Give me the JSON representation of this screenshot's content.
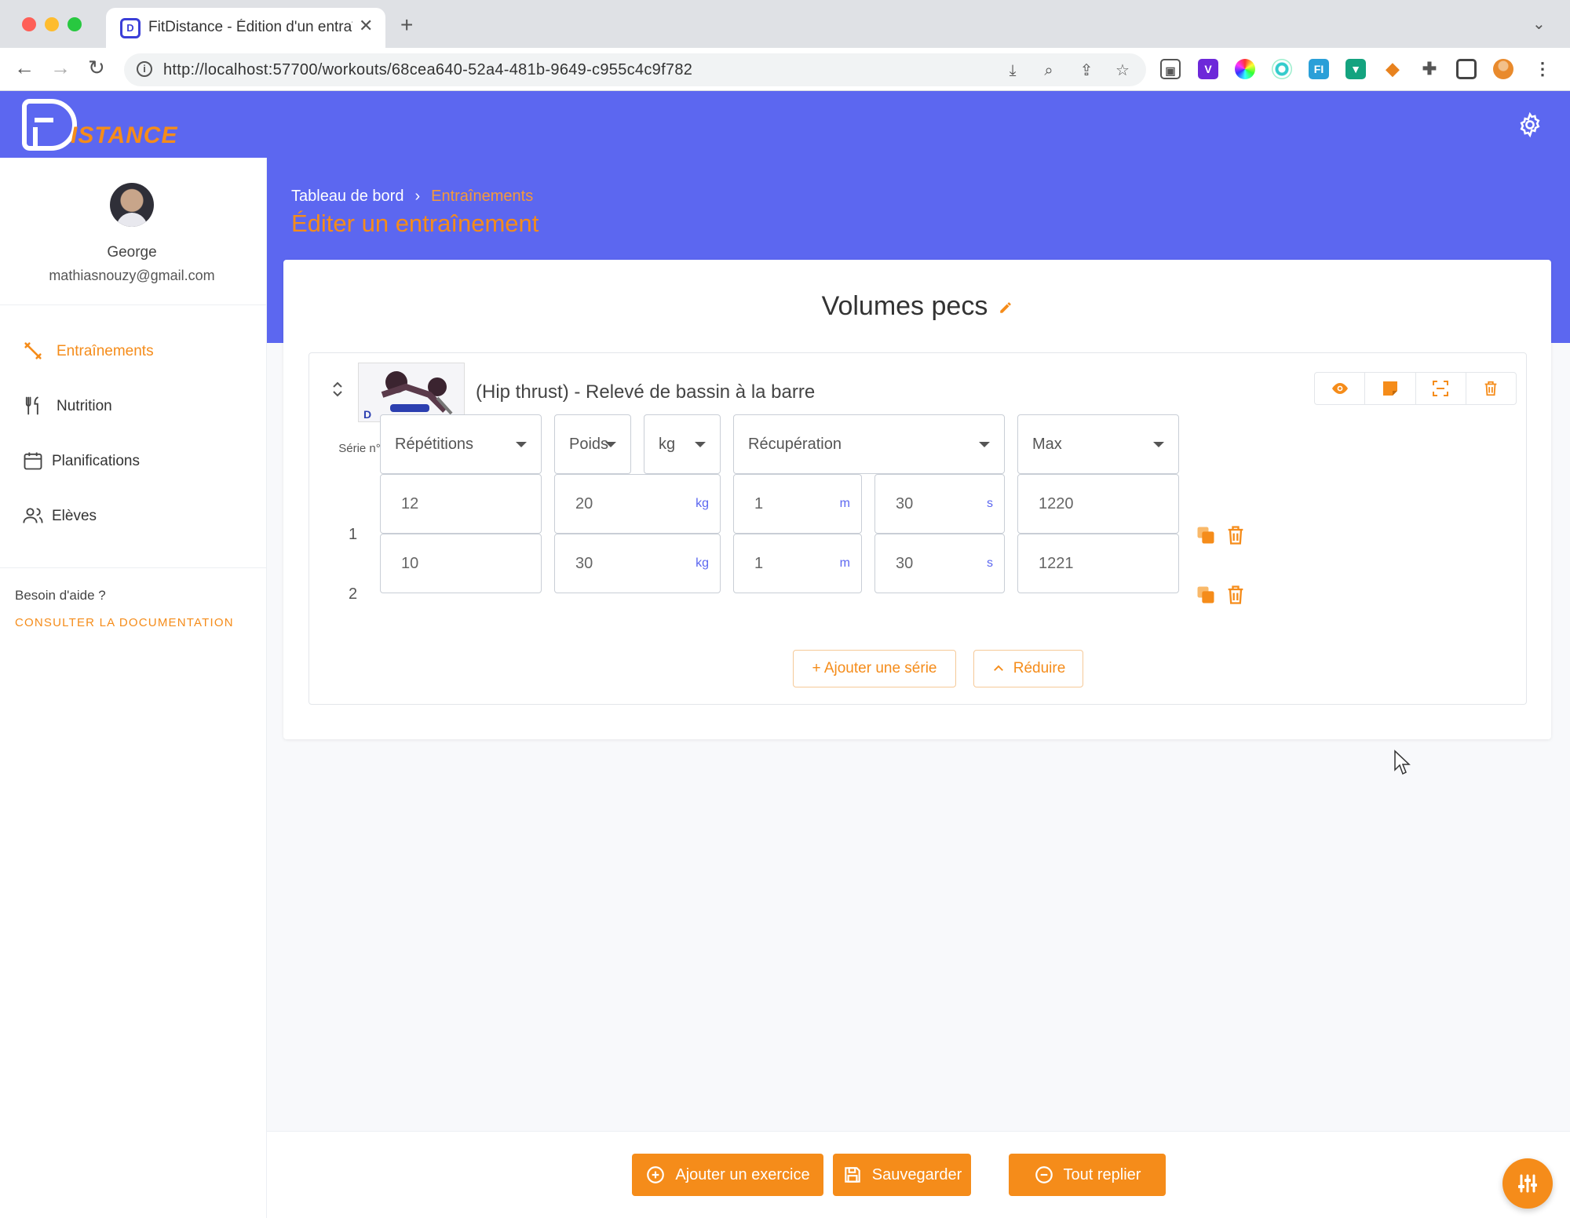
{
  "browser": {
    "tab_title": "FitDistance - Édition d'un entraî",
    "url": "http://localhost:57700/workouts/68cea640-52a4-481b-9649-c955c4c9f782"
  },
  "app": {
    "logo_text": "ISTANCE",
    "accent": "#f58c1a",
    "brand": "#5c67f0"
  },
  "user": {
    "name": "George",
    "email": "mathiasnouzy@gmail.com"
  },
  "sidebar": {
    "items": [
      {
        "label": "Entraînements",
        "icon": "dumbbell-icon",
        "active": true
      },
      {
        "label": "Nutrition",
        "icon": "utensils-icon",
        "active": false
      },
      {
        "label": "Planifications",
        "icon": "calendar-icon",
        "active": false
      },
      {
        "label": "Elèves",
        "icon": "users-icon",
        "active": false
      }
    ],
    "help_text": "Besoin d'aide ?",
    "doc_link": "CONSULTER LA DOCUMENTATION"
  },
  "page": {
    "breadcrumb": [
      "Tableau de bord",
      "Entraînements"
    ],
    "title": "Éditer un entraînement",
    "workout_title": "Volumes pecs"
  },
  "exercise": {
    "name": "(Hip thrust) - Relevé de bassin à la barre",
    "serie_header": "Série n°",
    "selects": {
      "reps": "Répétitions",
      "weight": "Poids",
      "unit": "kg",
      "rest": "Récupération",
      "max": "Max"
    },
    "rows": [
      {
        "n": "1",
        "reps": "12",
        "weight": "20",
        "weight_unit": "kg",
        "rest_m": "1",
        "m_unit": "m",
        "rest_s": "30",
        "s_unit": "s",
        "max": "1220"
      },
      {
        "n": "2",
        "reps": "10",
        "weight": "30",
        "weight_unit": "kg",
        "rest_m": "1",
        "m_unit": "m",
        "rest_s": "30",
        "s_unit": "s",
        "max": "1221"
      }
    ],
    "add_serie": "+ Ajouter une série",
    "reduce": "Réduire"
  },
  "footer": {
    "add_exercise": "Ajouter un exercice",
    "save": "Sauvegarder",
    "collapse_all": "Tout replier"
  }
}
